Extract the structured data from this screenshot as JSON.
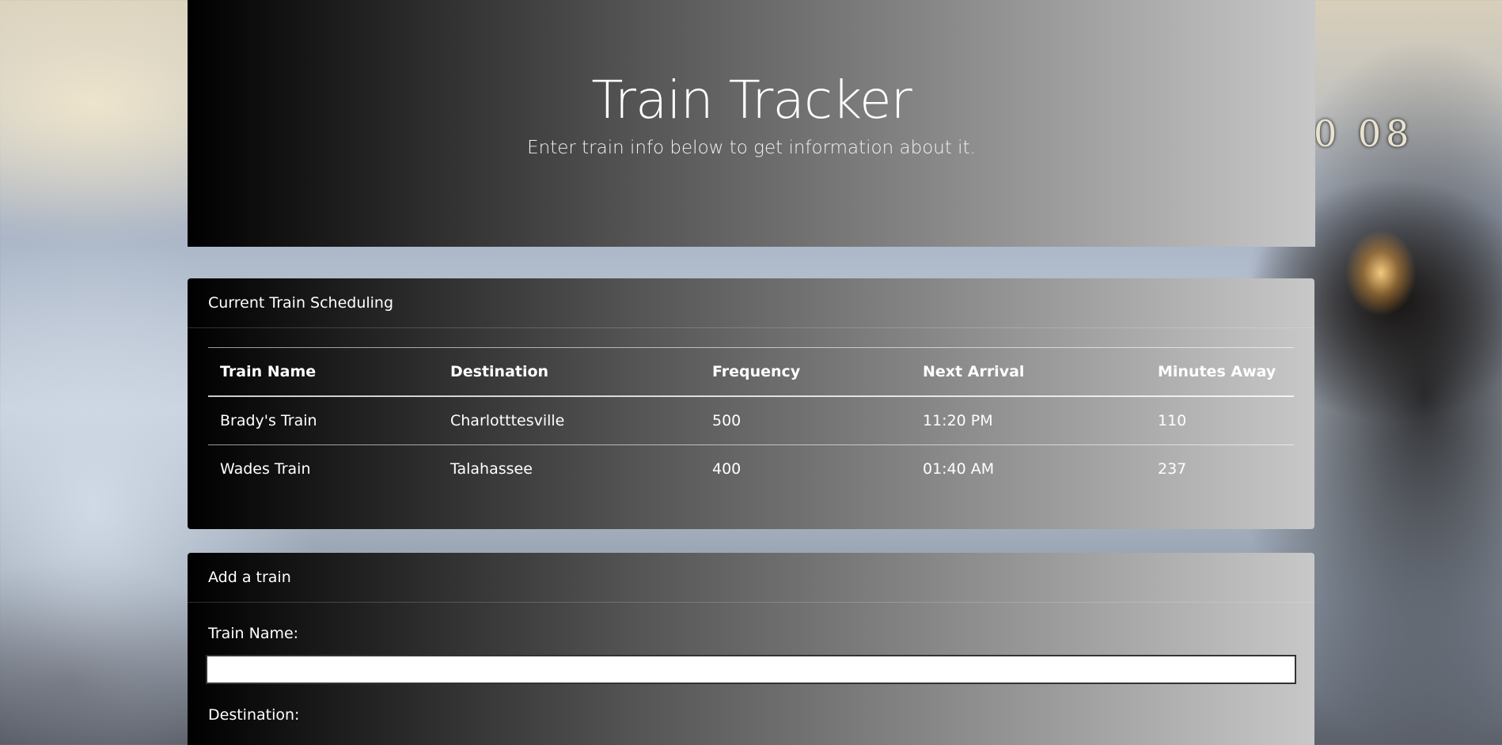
{
  "jumbotron": {
    "title": "Train Tracker",
    "subtitle": "Enter train info below to get information about it."
  },
  "schedule": {
    "header": "Current Train Scheduling",
    "columns": [
      "Train Name",
      "Destination",
      "Frequency",
      "Next Arrival",
      "Minutes Away"
    ],
    "rows": [
      [
        "Brady's Train",
        "Charlotttesville",
        "500",
        "11:20 PM",
        "110"
      ],
      [
        "Wades Train",
        "Talahassee",
        "400",
        "01:40 AM",
        "237"
      ]
    ]
  },
  "add_train": {
    "header": "Add a train",
    "train_name_label": "Train Name:",
    "train_name_value": "",
    "destination_label": "Destination:"
  },
  "background": {
    "plate_text": "0 08"
  }
}
